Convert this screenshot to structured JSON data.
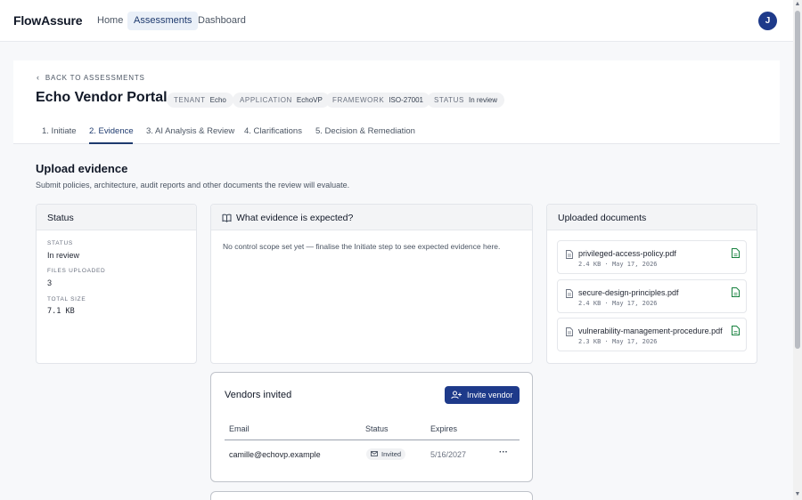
{
  "app": {
    "brand": "FlowAssure",
    "avatar_initial": "J"
  },
  "nav": [
    {
      "label": "Home"
    },
    {
      "label": "Assessments"
    },
    {
      "label": "Dashboard"
    }
  ],
  "header": {
    "back_label": "BACK TO ASSESSMENTS",
    "title": "Echo Vendor Portal",
    "chips": [
      {
        "key": "TENANT",
        "value": "Echo"
      },
      {
        "key": "APPLICATION",
        "value": "EchoVP"
      },
      {
        "key": "FRAMEWORK",
        "value": "ISO-27001"
      },
      {
        "key": "STATUS",
        "value": "In review"
      }
    ]
  },
  "tabs": [
    {
      "label": "1. Initiate"
    },
    {
      "label": "2. Evidence"
    },
    {
      "label": "3. AI Analysis & Review"
    },
    {
      "label": "4. Clarifications"
    },
    {
      "label": "5. Decision & Remediation"
    }
  ],
  "section": {
    "title": "Upload evidence",
    "subtitle": "Submit policies, architecture, audit reports and other documents the review will evaluate."
  },
  "status_card": {
    "title": "Status",
    "items": [
      {
        "label": "STATUS",
        "value": "In review"
      },
      {
        "label": "FILES UPLOADED",
        "value": "3"
      },
      {
        "label": "TOTAL SIZE",
        "value": "7.1 KB"
      }
    ]
  },
  "expected_card": {
    "title": "What evidence is expected?",
    "message": "No control scope set yet — finalise the Initiate step to see expected evidence here."
  },
  "uploaded_card": {
    "title": "Uploaded documents",
    "documents": [
      {
        "name": "privileged-access-policy.pdf",
        "size": "2.4 KB",
        "date": "May 17, 2026"
      },
      {
        "name": "secure-design-principles.pdf",
        "size": "2.4 KB",
        "date": "May 17, 2026"
      },
      {
        "name": "vulnerability-management-procedure.pdf",
        "size": "2.3 KB",
        "date": "May 17, 2026"
      }
    ],
    "meta_separator": "·"
  },
  "vendors": {
    "title": "Vendors invited",
    "invite_label": "Invite vendor",
    "columns": [
      "Email",
      "Status",
      "Expires"
    ],
    "rows": [
      {
        "email": "camille@echovp.example",
        "status": "Invited",
        "expires": "5/16/2027",
        "more": "···"
      }
    ]
  },
  "colors": {
    "accent": "#1e3a8a",
    "accent_text": "#1e3a6e",
    "background": "#f7f8fa"
  },
  "icons": {
    "back": "chevron-left-icon",
    "book": "book-open-icon",
    "file": "file-icon",
    "file_open": "file-check-icon",
    "invite": "user-plus-icon",
    "mail": "mail-icon",
    "more": "more-horizontal-icon"
  }
}
